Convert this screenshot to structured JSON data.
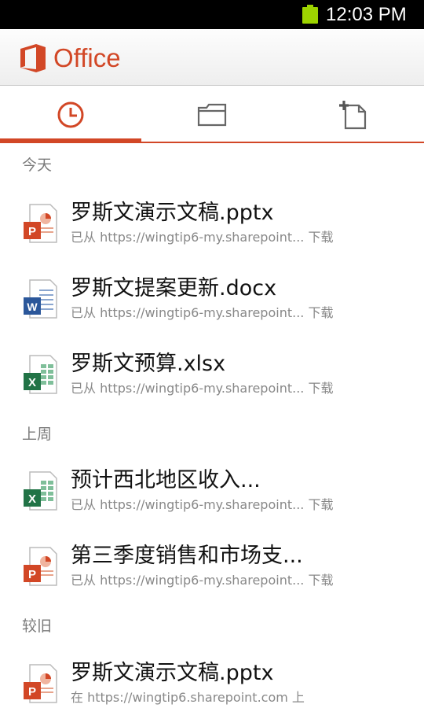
{
  "status_bar": {
    "time": "12:03 PM"
  },
  "app": {
    "brand": "Office"
  },
  "tabs": [
    {
      "icon": "clock-icon",
      "active": true
    },
    {
      "icon": "folder-icon",
      "active": false
    },
    {
      "icon": "new-document-icon",
      "active": false
    }
  ],
  "sections": [
    {
      "label": "今天"
    },
    {
      "label": "上周"
    },
    {
      "label": "较旧"
    }
  ],
  "files": [
    {
      "name": "罗斯文演示文稿.pptx",
      "meta": "已从 https://wingtip6-my.sharepoint... 下载",
      "type": "pptx-icon"
    },
    {
      "name": "罗斯文提案更新.docx",
      "meta": "已从 https://wingtip6-my.sharepoint... 下载",
      "type": "docx-icon"
    },
    {
      "name": "罗斯文预算.xlsx",
      "meta": "已从 https://wingtip6-my.sharepoint... 下载",
      "type": "xlsx-icon"
    },
    {
      "name": "预计西北地区收入...",
      "meta": "已从 https://wingtip6-my.sharepoint... 下载",
      "type": "xlsx-icon"
    },
    {
      "name": "第三季度销售和市场支...",
      "meta": "已从 https://wingtip6-my.sharepoint... 下载",
      "type": "pptx-icon"
    },
    {
      "name": "罗斯文演示文稿.pptx",
      "meta": "在 https://wingtip6.sharepoint.com 上",
      "type": "pptx-icon"
    }
  ],
  "colors": {
    "accent": "#d24726",
    "word": "#2b579a",
    "excel": "#217346",
    "powerpoint": "#d24726"
  }
}
